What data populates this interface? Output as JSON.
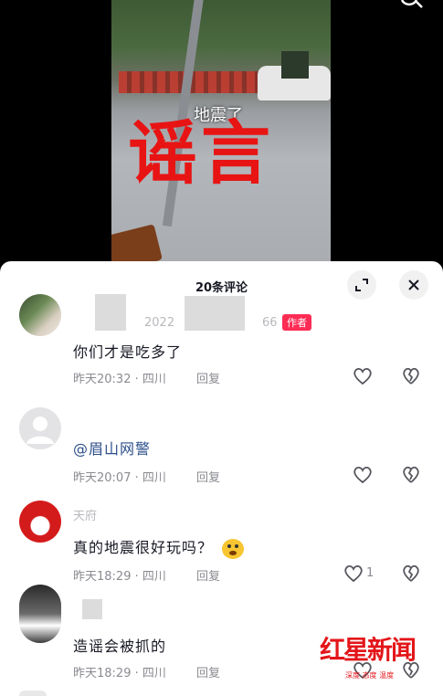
{
  "video": {
    "caption": "地震了",
    "overlay_text": "谣言"
  },
  "comments_panel": {
    "title": "20条评论",
    "comments": [
      {
        "name_fragment": "2022",
        "name_suffix": "66",
        "author_badge": "作者",
        "text": "你们才是吃多了",
        "time": "昨天20:32",
        "location": "四川",
        "reply_label": "回复"
      },
      {
        "text": "@眉山网警",
        "time": "昨天20:07",
        "location": "四川",
        "reply_label": "回复"
      },
      {
        "name_fragment": "天府",
        "text": "真的地震很好玩吗？",
        "time": "昨天18:29",
        "location": "四川",
        "reply_label": "回复",
        "like_count": "1"
      },
      {
        "text": "造谣会被抓的",
        "time": "昨天18:29",
        "location": "四川",
        "reply_label": "回复"
      }
    ]
  },
  "watermark": {
    "logo": "红星新闻",
    "slogan": "深度 态度 温度"
  },
  "colors": {
    "author_badge": "#fe2c55",
    "mention": "#2d4f8b",
    "rumor": "#e81414"
  }
}
